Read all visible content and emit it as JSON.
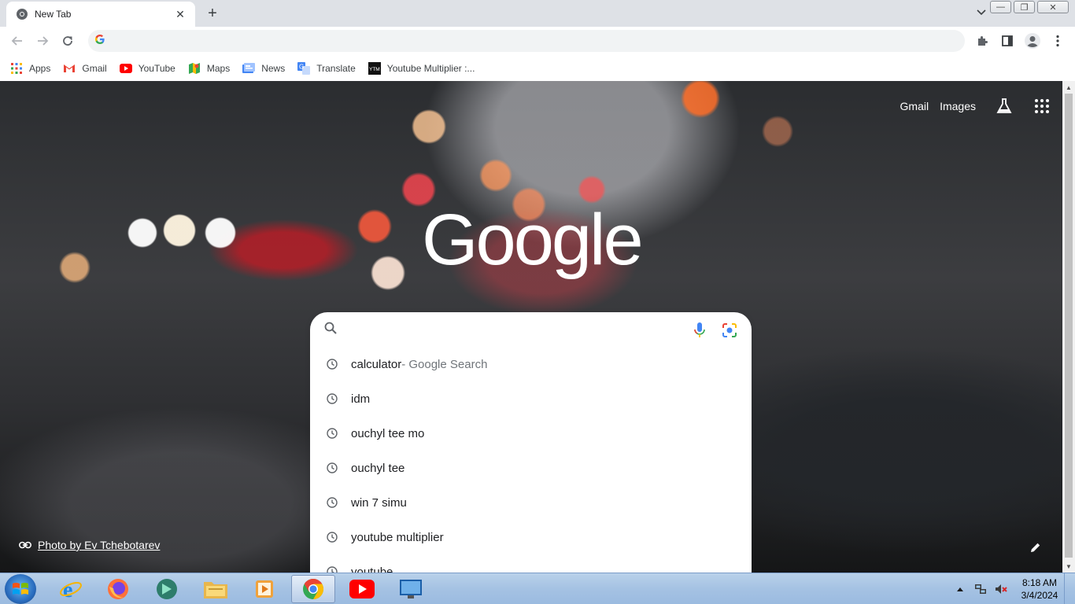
{
  "browser": {
    "tab": {
      "title": "New Tab"
    },
    "omnibox": {
      "value": "",
      "placeholder": ""
    },
    "bookmarks": [
      {
        "label": "Apps",
        "icon": "apps-grid-icon"
      },
      {
        "label": "Gmail",
        "icon": "gmail-icon"
      },
      {
        "label": "YouTube",
        "icon": "youtube-icon"
      },
      {
        "label": "Maps",
        "icon": "maps-icon"
      },
      {
        "label": "News",
        "icon": "news-icon"
      },
      {
        "label": "Translate",
        "icon": "translate-icon"
      },
      {
        "label": "Youtube Multiplier :...",
        "icon": "ytm-icon"
      }
    ]
  },
  "ntp": {
    "header_links": {
      "gmail": "Gmail",
      "images": "Images"
    },
    "logo_text": "Google",
    "search": {
      "value": "",
      "placeholder": ""
    },
    "suggestions": [
      {
        "text": "calculator",
        "suffix": " - Google Search"
      },
      {
        "text": "idm",
        "suffix": ""
      },
      {
        "text": "ouchyl tee mo",
        "suffix": ""
      },
      {
        "text": "ouchyl tee",
        "suffix": ""
      },
      {
        "text": "win 7 simu",
        "suffix": ""
      },
      {
        "text": "youtube multiplier",
        "suffix": ""
      },
      {
        "text": "youtube",
        "suffix": ""
      }
    ],
    "photo_credit": "Photo by Ev Tchebotarev"
  },
  "taskbar": {
    "apps": [
      "internet-explorer",
      "firefox",
      "ipvanish",
      "file-explorer",
      "media-player",
      "chrome",
      "youtube",
      "remote-desktop"
    ],
    "active_app": "chrome",
    "clock": {
      "time": "8:18 AM",
      "date": "3/4/2024"
    }
  },
  "colors": {
    "google_blue": "#4285f4",
    "google_red": "#ea4335",
    "google_yellow": "#fbbc05",
    "google_green": "#34a853",
    "tab_strip": "#dee1e6"
  }
}
